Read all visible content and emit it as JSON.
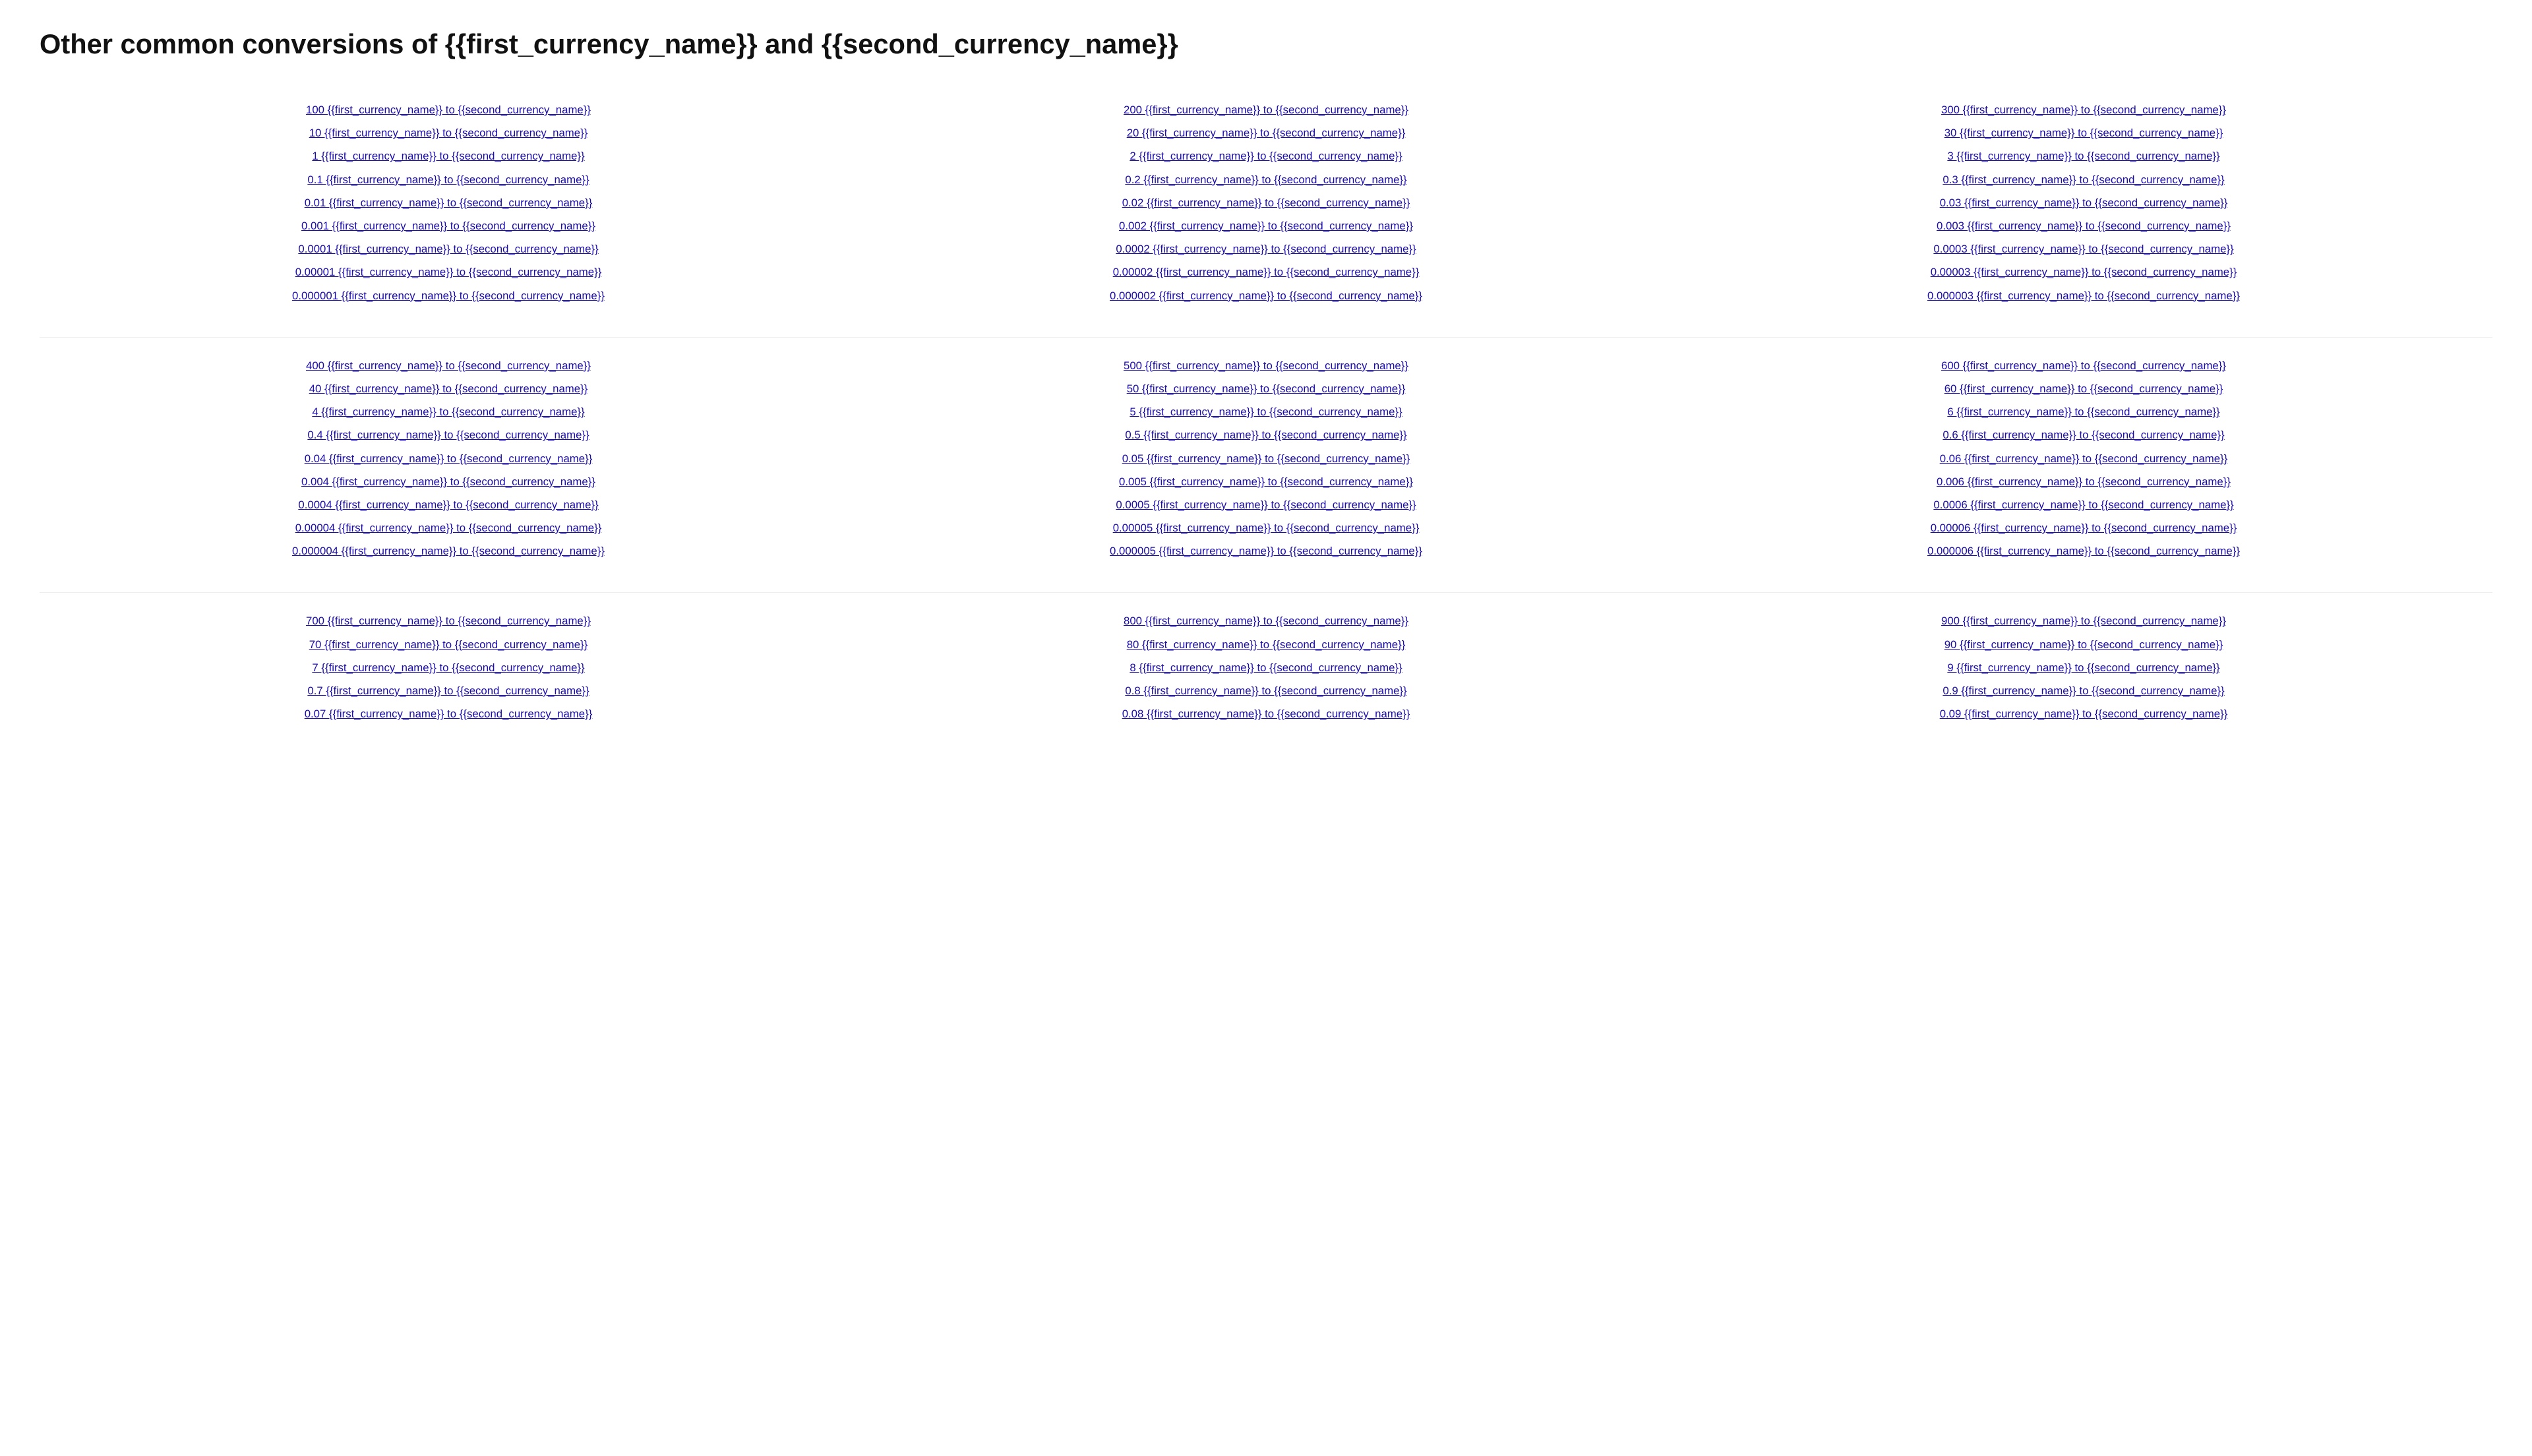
{
  "page": {
    "title": "Other common conversions of {{first_currency_name}} and {{second_currency_name}}"
  },
  "sections": [
    {
      "id": "section-1",
      "columns": [
        {
          "links": [
            "100 {{first_currency_name}} to {{second_currency_name}}",
            "10 {{first_currency_name}} to {{second_currency_name}}",
            "1 {{first_currency_name}} to {{second_currency_name}}",
            "0.1 {{first_currency_name}} to {{second_currency_name}}",
            "0.01 {{first_currency_name}} to {{second_currency_name}}",
            "0.001 {{first_currency_name}} to {{second_currency_name}}",
            "0.0001 {{first_currency_name}} to {{second_currency_name}}",
            "0.00001 {{first_currency_name}} to {{second_currency_name}}",
            "0.000001 {{first_currency_name}} to {{second_currency_name}}"
          ]
        },
        {
          "links": [
            "200 {{first_currency_name}} to {{second_currency_name}}",
            "20 {{first_currency_name}} to {{second_currency_name}}",
            "2 {{first_currency_name}} to {{second_currency_name}}",
            "0.2 {{first_currency_name}} to {{second_currency_name}}",
            "0.02 {{first_currency_name}} to {{second_currency_name}}",
            "0.002 {{first_currency_name}} to {{second_currency_name}}",
            "0.0002 {{first_currency_name}} to {{second_currency_name}}",
            "0.00002 {{first_currency_name}} to {{second_currency_name}}",
            "0.000002 {{first_currency_name}} to {{second_currency_name}}"
          ]
        },
        {
          "links": [
            "300 {{first_currency_name}} to {{second_currency_name}}",
            "30 {{first_currency_name}} to {{second_currency_name}}",
            "3 {{first_currency_name}} to {{second_currency_name}}",
            "0.3 {{first_currency_name}} to {{second_currency_name}}",
            "0.03 {{first_currency_name}} to {{second_currency_name}}",
            "0.003 {{first_currency_name}} to {{second_currency_name}}",
            "0.0003 {{first_currency_name}} to {{second_currency_name}}",
            "0.00003 {{first_currency_name}} to {{second_currency_name}}",
            "0.000003 {{first_currency_name}} to {{second_currency_name}}"
          ]
        }
      ]
    },
    {
      "id": "section-2",
      "columns": [
        {
          "links": [
            "400 {{first_currency_name}} to {{second_currency_name}}",
            "40 {{first_currency_name}} to {{second_currency_name}}",
            "4 {{first_currency_name}} to {{second_currency_name}}",
            "0.4 {{first_currency_name}} to {{second_currency_name}}",
            "0.04 {{first_currency_name}} to {{second_currency_name}}",
            "0.004 {{first_currency_name}} to {{second_currency_name}}",
            "0.0004 {{first_currency_name}} to {{second_currency_name}}",
            "0.00004 {{first_currency_name}} to {{second_currency_name}}",
            "0.000004 {{first_currency_name}} to {{second_currency_name}}"
          ]
        },
        {
          "links": [
            "500 {{first_currency_name}} to {{second_currency_name}}",
            "50 {{first_currency_name}} to {{second_currency_name}}",
            "5 {{first_currency_name}} to {{second_currency_name}}",
            "0.5 {{first_currency_name}} to {{second_currency_name}}",
            "0.05 {{first_currency_name}} to {{second_currency_name}}",
            "0.005 {{first_currency_name}} to {{second_currency_name}}",
            "0.0005 {{first_currency_name}} to {{second_currency_name}}",
            "0.00005 {{first_currency_name}} to {{second_currency_name}}",
            "0.000005 {{first_currency_name}} to {{second_currency_name}}"
          ]
        },
        {
          "links": [
            "600 {{first_currency_name}} to {{second_currency_name}}",
            "60 {{first_currency_name}} to {{second_currency_name}}",
            "6 {{first_currency_name}} to {{second_currency_name}}",
            "0.6 {{first_currency_name}} to {{second_currency_name}}",
            "0.06 {{first_currency_name}} to {{second_currency_name}}",
            "0.006 {{first_currency_name}} to {{second_currency_name}}",
            "0.0006 {{first_currency_name}} to {{second_currency_name}}",
            "0.00006 {{first_currency_name}} to {{second_currency_name}}",
            "0.000006 {{first_currency_name}} to {{second_currency_name}}"
          ]
        }
      ]
    },
    {
      "id": "section-3",
      "columns": [
        {
          "links": [
            "700 {{first_currency_name}} to {{second_currency_name}}",
            "70 {{first_currency_name}} to {{second_currency_name}}",
            "7 {{first_currency_name}} to {{second_currency_name}}",
            "0.7 {{first_currency_name}} to {{second_currency_name}}",
            "0.07 {{first_currency_name}} to {{second_currency_name}}"
          ]
        },
        {
          "links": [
            "800 {{first_currency_name}} to {{second_currency_name}}",
            "80 {{first_currency_name}} to {{second_currency_name}}",
            "8 {{first_currency_name}} to {{second_currency_name}}",
            "0.8 {{first_currency_name}} to {{second_currency_name}}",
            "0.08 {{first_currency_name}} to {{second_currency_name}}"
          ]
        },
        {
          "links": [
            "900 {{first_currency_name}} to {{second_currency_name}}",
            "90 {{first_currency_name}} to {{second_currency_name}}",
            "9 {{first_currency_name}} to {{second_currency_name}}",
            "0.9 {{first_currency_name}} to {{second_currency_name}}",
            "0.09 {{first_currency_name}} to {{second_currency_name}}"
          ]
        }
      ]
    }
  ]
}
